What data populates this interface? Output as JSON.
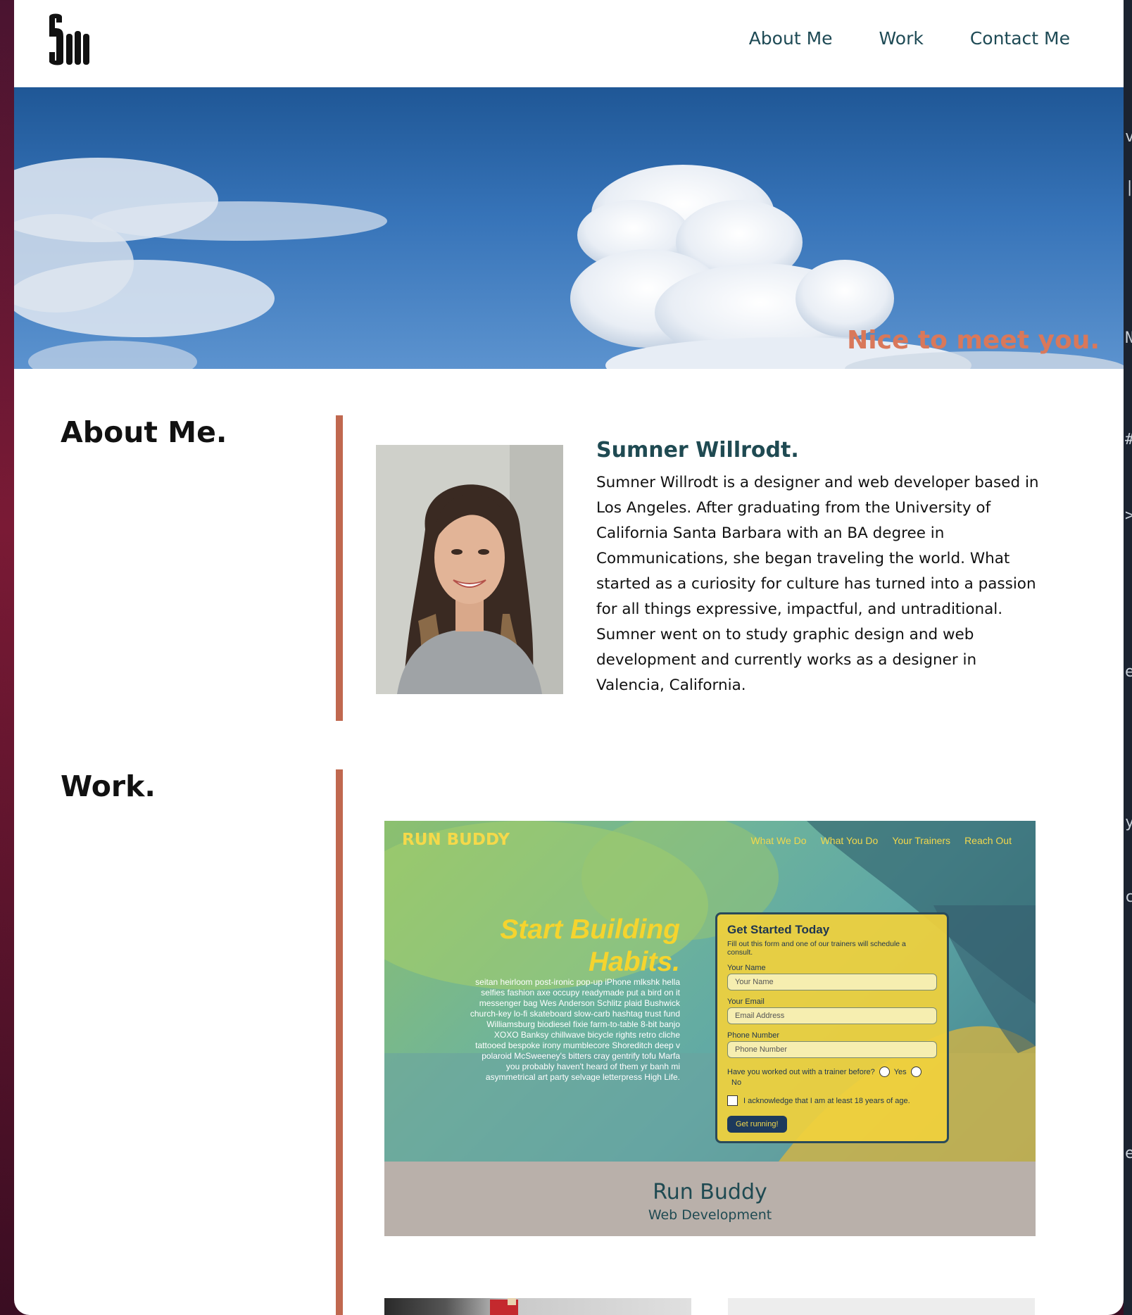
{
  "nav": {
    "items": [
      "About Me",
      "Work",
      "Contact Me"
    ]
  },
  "hero": {
    "tagline": "Nice to meet you."
  },
  "about": {
    "heading": "About Me.",
    "name": "Sumner Willrodt.",
    "bio": "Sumner Willrodt is a designer and web developer based in Los Angeles. After graduating from the University of California Santa Barbara with an BA degree in Communications, she began traveling the world. What started as a curiosity for culture has turned into a passion for all things expressive, impactful, and untraditional. Sumner went on to study graphic design and web development and currently works as a designer in Valencia, California."
  },
  "work": {
    "heading": "Work.",
    "projects": [
      {
        "title": "Run Buddy",
        "subtitle": "Web Development",
        "preview": {
          "brand": "RUN BUDDY",
          "nav": [
            "What We Do",
            "What You Do",
            "Your Trainers",
            "Reach Out"
          ],
          "headline_line1": "Start Building",
          "headline_line2": "Habits.",
          "body": "seitan heirloom post-ironic pop-up iPhone mlkshk hella selfies fashion axe occupy readymade put a bird on it messenger bag Wes Anderson Schlitz plaid Bushwick church-key lo-fi skateboard slow-carb hashtag trust fund Williamsburg biodiesel fixie farm-to-table 8-bit banjo XOXO Banksy chillwave bicycle rights retro cliche tattooed bespoke irony mumblecore Shoreditch deep v polaroid McSweeney's bitters cray gentrify tofu Marfa you probably haven't heard of them yr banh mi asymmetrical art party selvage letterpress High Life.",
          "form": {
            "title": "Get Started Today",
            "note": "Fill out this form and one of our trainers will schedule a consult.",
            "name_label": "Your Name",
            "name_placeholder": "Your Name",
            "email_label": "Your Email",
            "email_placeholder": "Email Address",
            "phone_label": "Phone Number",
            "phone_placeholder": "Phone Number",
            "question": "Have you worked out with a trainer before?",
            "yes": "Yes",
            "no": "No",
            "checkbox": "I acknowledge that I am at least 18 years of age.",
            "submit": "Get running!"
          }
        }
      }
    ]
  },
  "colors": {
    "accent": "#c0684f",
    "nav_text": "#1e4a55",
    "tagline": "#d9785a",
    "card_bg": "#b9b0aa"
  }
}
